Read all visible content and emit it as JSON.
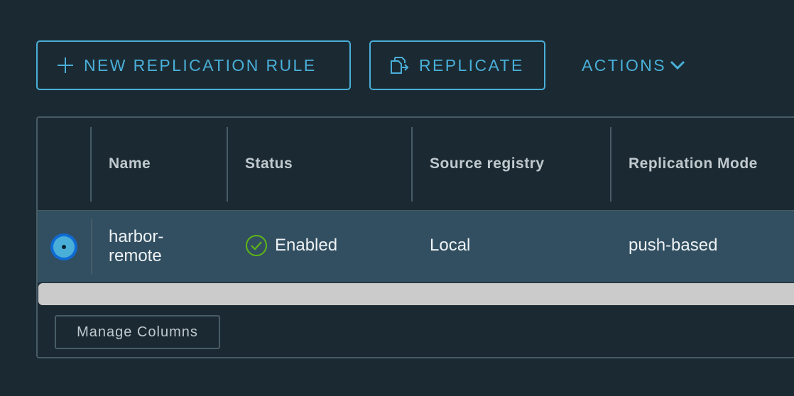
{
  "toolbar": {
    "new_rule_label": "New Replication Rule",
    "replicate_label": "Replicate",
    "actions_label": "Actions"
  },
  "grid": {
    "columns": [
      "Name",
      "Status",
      "Source registry",
      "Replication Mode"
    ],
    "rows": [
      {
        "name_line1": "harbor-",
        "name_line2": "remote",
        "status": "Enabled",
        "source_registry": "Local",
        "replication_mode": "push-based",
        "selected": true
      }
    ],
    "manage_columns_label": "Manage Columns"
  },
  "colors": {
    "background": "#1b2a32",
    "accent": "#49afd9",
    "selected_row": "#324f61",
    "status_ok": "#5eb715",
    "border": "#485c66"
  },
  "icons": {
    "new_rule": "plus-icon",
    "replicate": "replicate-icon",
    "actions": "chevron-down-icon",
    "status": "check-circle-icon"
  }
}
